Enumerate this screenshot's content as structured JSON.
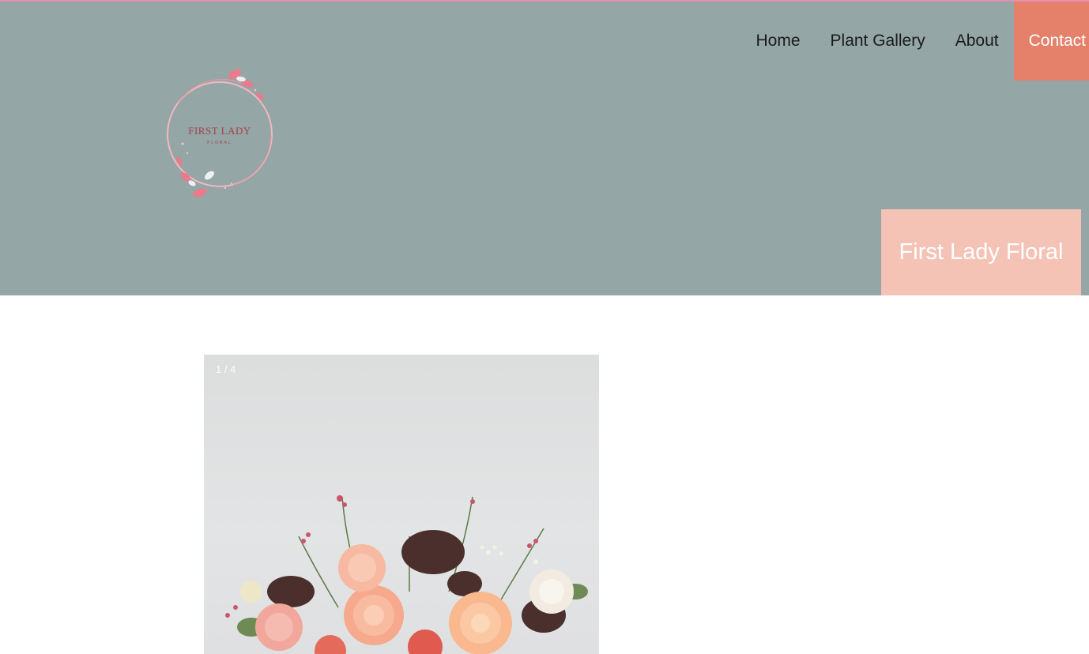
{
  "nav": {
    "items": [
      {
        "label": "Home"
      },
      {
        "label": "Plant Gallery"
      },
      {
        "label": "About"
      },
      {
        "label": "Contact"
      }
    ]
  },
  "logo": {
    "name": "FIRST LADY",
    "sub": "FLORAL"
  },
  "site_title": "First Lady Floral",
  "slideshow": {
    "counter": "1 / 4",
    "image": "flower-bouquet-photo"
  },
  "colors": {
    "header_bg": "#94a6a5",
    "accent_top": "#e58fb0",
    "nav_active_bg": "#e5816a",
    "title_block_bg": "#f4c3b6"
  }
}
